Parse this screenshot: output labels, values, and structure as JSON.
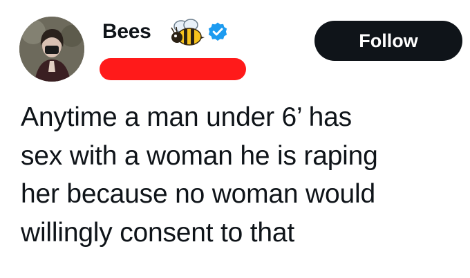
{
  "author": {
    "display_name": "Bees",
    "badge_emoji_icon": "bee-icon",
    "verified_icon": "verified-badge-icon",
    "handle_redaction_color": "#ff1a1a",
    "verified_color": "#1d9bf0"
  },
  "actions": {
    "follow_label": "Follow"
  },
  "post": {
    "text": "Anytime a man under 6’ has\nsex with a woman he is raping\nher because no woman would\nwillingly consent to that"
  }
}
